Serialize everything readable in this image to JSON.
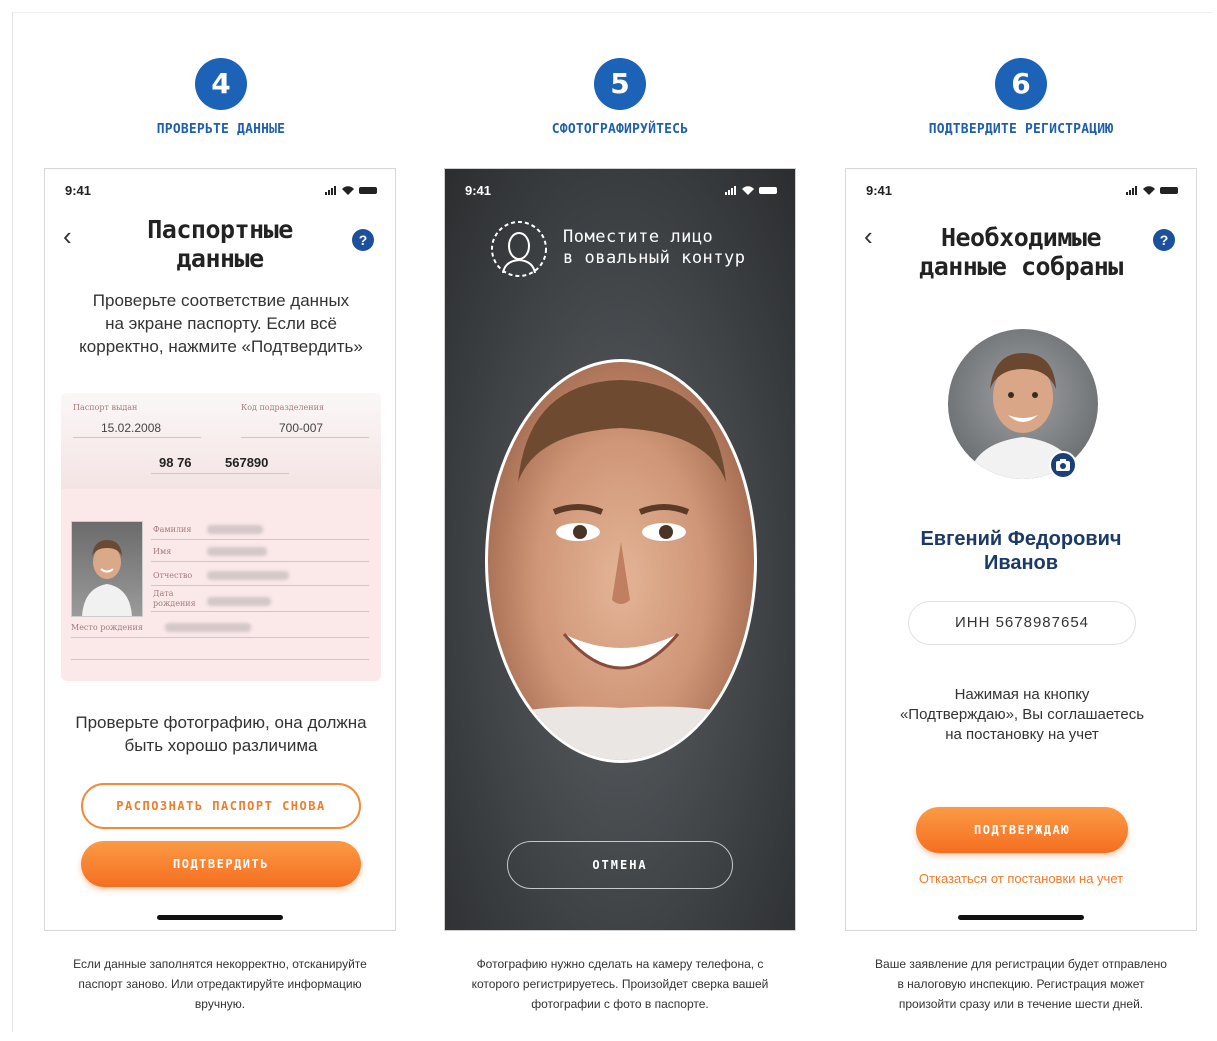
{
  "steps": [
    {
      "number": "4",
      "title": "ПРОВЕРЬТЕ ДАННЫЕ"
    },
    {
      "number": "5",
      "title": "СФОТОГРАФИРУЙТЕСЬ"
    },
    {
      "number": "6",
      "title": "ПОДТВЕРДИТЕ РЕГИСТРАЦИЮ"
    }
  ],
  "status_bar": {
    "time": "9:41"
  },
  "passport_screen": {
    "title_line1": "Паспортные",
    "title_line2": "данные",
    "help_label": "?",
    "intro_line1": "Проверьте соответствие данных",
    "intro_line2": "на экране паспорту. Если всё",
    "intro_line3": "корректно, нажмите «Подтвердить»",
    "passport": {
      "issued_label": "Паспорт выдан",
      "issued_value": "15.02.2008",
      "code_label": "Код подразделения",
      "code_value": "700-007",
      "series": "98 76",
      "number": "567890",
      "surname_label": "Фамилия",
      "name_label": "Имя",
      "patronymic_label": "Отчество",
      "birthdate_label_line1": "Дата",
      "birthdate_label_line2": "рождения",
      "birthplace_label": "Место рождения"
    },
    "photo_hint_line1": "Проверьте фотографию, она должна",
    "photo_hint_line2": "быть хорошо различима",
    "rescan_button": "РАСПОЗНАТЬ ПАСПОРТ СНОВА",
    "confirm_button": "ПОДТВЕРДИТЬ"
  },
  "camera_screen": {
    "hint_line1": "Поместите лицо",
    "hint_line2": "в овальный контур",
    "cancel_button": "ОТМЕНА"
  },
  "done_screen": {
    "title_line1": "Необходимые",
    "title_line2": "данные собраны",
    "help_label": "?",
    "name_line1": "Евгений Федорович",
    "name_line2": "Иванов",
    "inn": "ИНН 5678987654",
    "consent_line1": "Нажимая на кнопку",
    "consent_line2": "«Подтверждаю», Вы соглашаетесь",
    "consent_line3": "на постановку на учет",
    "confirm_button": "ПОДТВЕРЖДАЮ",
    "decline_link": "Отказаться от постановки на учет"
  },
  "captions": [
    {
      "line1": "Если данные заполнятся некорректно, отсканируйте",
      "line2": "паспорт заново. Или отредактируйте информацию",
      "line3": "вручную."
    },
    {
      "line1": "Фотографию нужно сделать на камеру телефона, с",
      "line2": "которого регистрируетесь. Произойдет сверка вашей",
      "line3": "фотографии с фото в паспорте."
    },
    {
      "line1": "Ваше заявление для регистрации будет отправлено",
      "line2": "в налоговую инспекцию. Регистрация может",
      "line3": "произойти сразу или в течение шести дней."
    }
  ],
  "colors": {
    "accent_blue": "#1c63b8",
    "accent_orange": "#f56e20",
    "name_navy": "#1c3a68"
  }
}
